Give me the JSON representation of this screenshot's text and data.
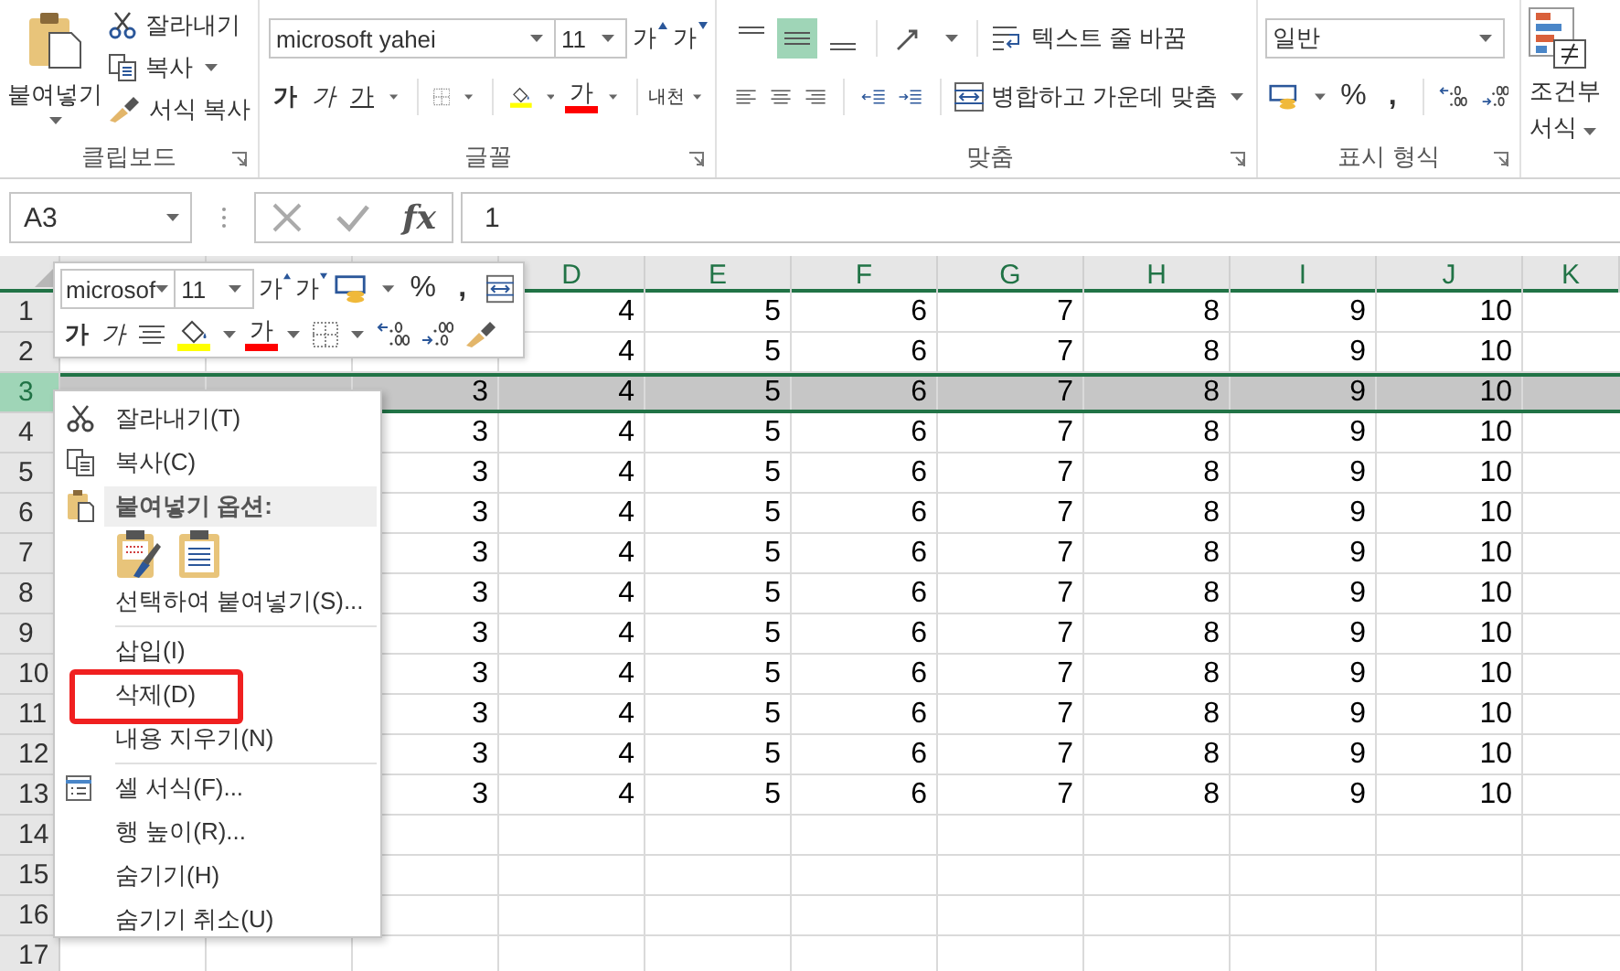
{
  "ribbon": {
    "clipboard": {
      "paste": "붙여넣기",
      "cut": "잘라내기",
      "copy": "복사",
      "format_painter": "서식 복사",
      "label": "클립보드"
    },
    "font": {
      "font_name": "microsoft yahei",
      "font_size": "11",
      "grow": "가",
      "shrink": "가",
      "bold": "가",
      "italic": "가",
      "underline": "가",
      "font_color": "가",
      "phonetic": "내천",
      "label": "글꼴"
    },
    "alignment": {
      "vertical": [
        {
          "selected": false
        },
        {
          "selected": true
        },
        {
          "selected": false
        }
      ],
      "wrap_text": "텍스트 줄 바꿈",
      "merge_center": "병합하고 가운데 맞춤",
      "label": "맞춤"
    },
    "number": {
      "format": "일반",
      "percent": "%",
      "comma": ",",
      "label": "표시 형식"
    },
    "styles": {
      "conditional_formatting": "조건부 서식"
    }
  },
  "formula_bar": {
    "name_box": "A3",
    "fx": "fx",
    "formula": "1"
  },
  "grid": {
    "columns": [
      "D",
      "E",
      "F",
      "G",
      "H",
      "I",
      "J",
      "K"
    ],
    "rows": [
      {
        "label": "1",
        "selected": false,
        "cells": [
          "4",
          "5",
          "6",
          "7",
          "8",
          "9",
          "10"
        ]
      },
      {
        "label": "2",
        "selected": false,
        "cells": [
          "4",
          "5",
          "6",
          "7",
          "8",
          "9",
          "10"
        ]
      },
      {
        "label": "3",
        "selected": true,
        "cells": [
          "3",
          "4",
          "5",
          "6",
          "7",
          "8",
          "9",
          "10"
        ]
      },
      {
        "label": "4",
        "selected": false,
        "cells": [
          "3",
          "4",
          "5",
          "6",
          "7",
          "8",
          "9",
          "10"
        ]
      },
      {
        "label": "5",
        "selected": false,
        "cells": [
          "3",
          "4",
          "5",
          "6",
          "7",
          "8",
          "9",
          "10"
        ]
      },
      {
        "label": "6",
        "selected": false,
        "cells": [
          "3",
          "4",
          "5",
          "6",
          "7",
          "8",
          "9",
          "10"
        ]
      },
      {
        "label": "7",
        "selected": false,
        "cells": [
          "3",
          "4",
          "5",
          "6",
          "7",
          "8",
          "9",
          "10"
        ]
      },
      {
        "label": "8",
        "selected": false,
        "cells": [
          "3",
          "4",
          "5",
          "6",
          "7",
          "8",
          "9",
          "10"
        ]
      },
      {
        "label": "9",
        "selected": false,
        "cells": [
          "3",
          "4",
          "5",
          "6",
          "7",
          "8",
          "9",
          "10"
        ]
      },
      {
        "label": "10",
        "selected": false,
        "cells": [
          "3",
          "4",
          "5",
          "6",
          "7",
          "8",
          "9",
          "10"
        ]
      },
      {
        "label": "11",
        "selected": false,
        "cells": [
          "3",
          "4",
          "5",
          "6",
          "7",
          "8",
          "9",
          "10"
        ]
      },
      {
        "label": "12",
        "selected": false,
        "cells": [
          "3",
          "4",
          "5",
          "6",
          "7",
          "8",
          "9",
          "10"
        ]
      },
      {
        "label": "13",
        "selected": false,
        "cells": [
          "3",
          "4",
          "5",
          "6",
          "7",
          "8",
          "9",
          "10"
        ]
      },
      {
        "label": "14",
        "selected": false,
        "cells": []
      },
      {
        "label": "15",
        "selected": false,
        "cells": []
      },
      {
        "label": "16",
        "selected": false,
        "cells": []
      },
      {
        "label": "17",
        "selected": false,
        "cells": []
      }
    ]
  },
  "mini_toolbar": {
    "font_name": "microsof",
    "font_size": "11",
    "grow": "가",
    "shrink": "가",
    "percent": "%",
    "comma": ",",
    "bold": "가",
    "italic": "가",
    "font_color": "가"
  },
  "context_menu": [
    {
      "kind": "item",
      "label": "잘라내기(T)"
    },
    {
      "kind": "item",
      "label": "복사(C)"
    },
    {
      "kind": "header",
      "label": "붙여넣기 옵션:"
    },
    {
      "kind": "paste_options"
    },
    {
      "kind": "item",
      "label": "선택하여 붙여넣기(S)..."
    },
    {
      "kind": "separator"
    },
    {
      "kind": "item",
      "label": "삽입(I)"
    },
    {
      "kind": "item",
      "label": "삭제(D)"
    },
    {
      "kind": "item",
      "label": "내용 지우기(N)"
    },
    {
      "kind": "separator"
    },
    {
      "kind": "item",
      "label": "셀 서식(F)..."
    },
    {
      "kind": "item",
      "label": "행 높이(R)..."
    },
    {
      "kind": "item",
      "label": "숨기기(H)"
    },
    {
      "kind": "item",
      "label": "숨기기 취소(U)"
    }
  ]
}
